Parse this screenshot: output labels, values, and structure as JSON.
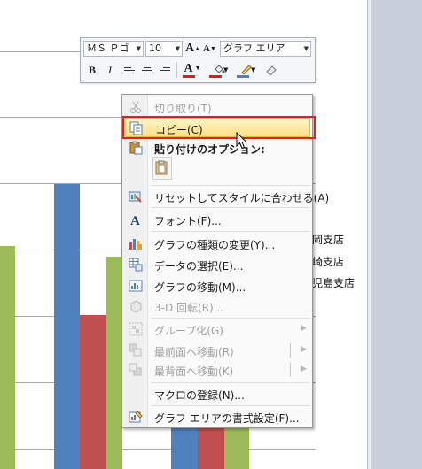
{
  "mini_toolbar": {
    "font_name": "ＭＳ Ｐゴ",
    "font_size": "10",
    "element_select": "グラフ エリア",
    "bold_label": "B",
    "italic_label": "I",
    "font_color_label": "A",
    "grow_font_label": "A",
    "shrink_font_label": "A",
    "colors": {
      "font": "#e11a1a",
      "fill": "#e11a1a",
      "outline": "#4f81bd"
    }
  },
  "chart": {
    "bar_colors": [
      "#9bbb59",
      "#4f81bd",
      "#c0504d"
    ],
    "legend_partial": [
      "岡支店",
      "崎支店",
      "児島支店"
    ]
  },
  "context_menu": {
    "items": [
      {
        "label": "切り取り(T)",
        "icon": "scissors-icon",
        "enabled": false
      },
      {
        "label": "コピー(C)",
        "icon": "copy-icon",
        "enabled": true,
        "highlighted": true
      },
      {
        "label": "貼り付けのオプション:",
        "icon": "paste-icon",
        "enabled": true,
        "header": true
      },
      {
        "label": "リセットしてスタイルに合わせる(A)",
        "icon": "reset-style-icon",
        "enabled": true
      },
      {
        "label": "フォント(F)...",
        "icon": "font-icon",
        "enabled": true
      },
      {
        "label": "グラフの種類の変更(Y)...",
        "icon": "chart-type-icon",
        "enabled": true
      },
      {
        "label": "データの選択(E)...",
        "icon": "select-data-icon",
        "enabled": true
      },
      {
        "label": "グラフの移動(M)...",
        "icon": "move-chart-icon",
        "enabled": true
      },
      {
        "label": "3-D 回転(R)...",
        "icon": "rotate-3d-icon",
        "enabled": false
      },
      {
        "label": "グループ化(G)",
        "icon": "group-icon",
        "enabled": false,
        "submenu": true
      },
      {
        "label": "最前面へ移動(R)",
        "icon": "bring-front-icon",
        "enabled": false,
        "submenu": true
      },
      {
        "label": "最背面へ移動(K)",
        "icon": "send-back-icon",
        "enabled": false,
        "submenu": true
      },
      {
        "label": "マクロの登録(N)...",
        "icon": "macro-icon",
        "enabled": true
      },
      {
        "label": "グラフ エリアの書式設定(F)...",
        "icon": "format-area-icon",
        "enabled": true
      }
    ]
  }
}
